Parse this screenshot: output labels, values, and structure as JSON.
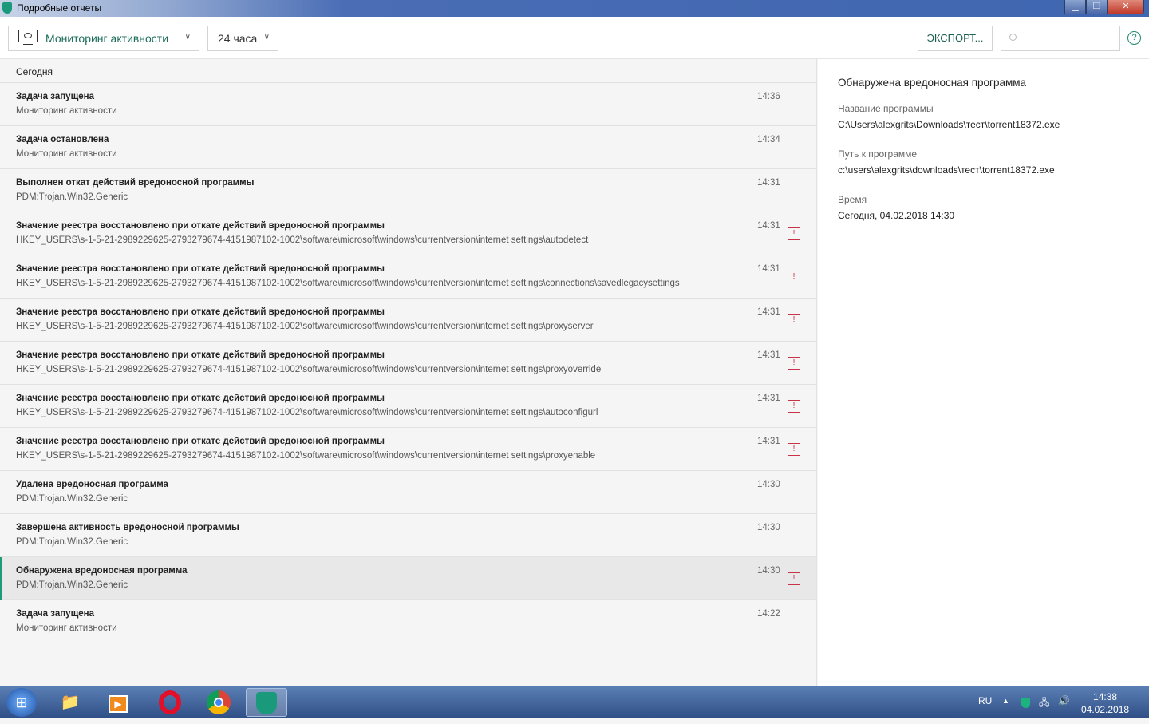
{
  "window": {
    "title": "Подробные отчеты"
  },
  "toolbar": {
    "component": "Мониторинг активности",
    "period": "24 часа",
    "export_label": "ЭКСПОРТ...",
    "search_placeholder": "",
    "help": "?"
  },
  "list": {
    "group": "Сегодня",
    "rows": [
      {
        "title": "Задача запущена",
        "sub": "Мониторинг активности",
        "time": "14:36",
        "warn": false
      },
      {
        "title": "Задача остановлена",
        "sub": "Мониторинг активности",
        "time": "14:34",
        "warn": false
      },
      {
        "title": "Выполнен откат действий вредоносной программы",
        "sub": "PDM:Trojan.Win32.Generic",
        "time": "14:31",
        "warn": false
      },
      {
        "title": "Значение реестра восстановлено при откате действий вредоносной программы",
        "sub": "HKEY_USERS\\s-1-5-21-2989229625-2793279674-4151987102-1002\\software\\microsoft\\windows\\currentversion\\internet settings\\autodetect",
        "time": "14:31",
        "warn": true
      },
      {
        "title": "Значение реестра восстановлено при откате действий вредоносной программы",
        "sub": "HKEY_USERS\\s-1-5-21-2989229625-2793279674-4151987102-1002\\software\\microsoft\\windows\\currentversion\\internet settings\\connections\\savedlegacysettings",
        "time": "14:31",
        "warn": true
      },
      {
        "title": "Значение реестра восстановлено при откате действий вредоносной программы",
        "sub": "HKEY_USERS\\s-1-5-21-2989229625-2793279674-4151987102-1002\\software\\microsoft\\windows\\currentversion\\internet settings\\proxyserver",
        "time": "14:31",
        "warn": true
      },
      {
        "title": "Значение реестра восстановлено при откате действий вредоносной программы",
        "sub": "HKEY_USERS\\s-1-5-21-2989229625-2793279674-4151987102-1002\\software\\microsoft\\windows\\currentversion\\internet settings\\proxyoverride",
        "time": "14:31",
        "warn": true
      },
      {
        "title": "Значение реестра восстановлено при откате действий вредоносной программы",
        "sub": "HKEY_USERS\\s-1-5-21-2989229625-2793279674-4151987102-1002\\software\\microsoft\\windows\\currentversion\\internet settings\\autoconfigurl",
        "time": "14:31",
        "warn": true
      },
      {
        "title": "Значение реестра восстановлено при откате действий вредоносной программы",
        "sub": "HKEY_USERS\\s-1-5-21-2989229625-2793279674-4151987102-1002\\software\\microsoft\\windows\\currentversion\\internet settings\\proxyenable",
        "time": "14:31",
        "warn": true
      },
      {
        "title": "Удалена вредоносная программа",
        "sub": "PDM:Trojan.Win32.Generic",
        "time": "14:30",
        "warn": false
      },
      {
        "title": "Завершена активность вредоносной программы",
        "sub": "PDM:Trojan.Win32.Generic",
        "time": "14:30",
        "warn": false
      },
      {
        "title": "Обнаружена вредоносная программа",
        "sub": "PDM:Trojan.Win32.Generic",
        "time": "14:30",
        "warn": true,
        "selected": true
      },
      {
        "title": "Задача запущена",
        "sub": "Мониторинг активности",
        "time": "14:22",
        "warn": false
      }
    ]
  },
  "detail": {
    "title": "Обнаружена вредоносная программа",
    "fields": [
      {
        "label": "Название программы",
        "value": "C:\\Users\\alexgrits\\Downloads\\тест\\torrent18372.exe"
      },
      {
        "label": "Путь к программе",
        "value": "c:\\users\\alexgrits\\downloads\\тест\\torrent18372.exe"
      },
      {
        "label": "Время",
        "value": "Сегодня, 04.02.2018 14:30"
      }
    ]
  },
  "taskbar": {
    "lang": "RU",
    "time": "14:38",
    "date": "04.02.2018",
    "apps": [
      "explorer-icon",
      "media-player-icon",
      "opera-icon",
      "chrome-icon",
      "kaspersky-icon"
    ]
  }
}
